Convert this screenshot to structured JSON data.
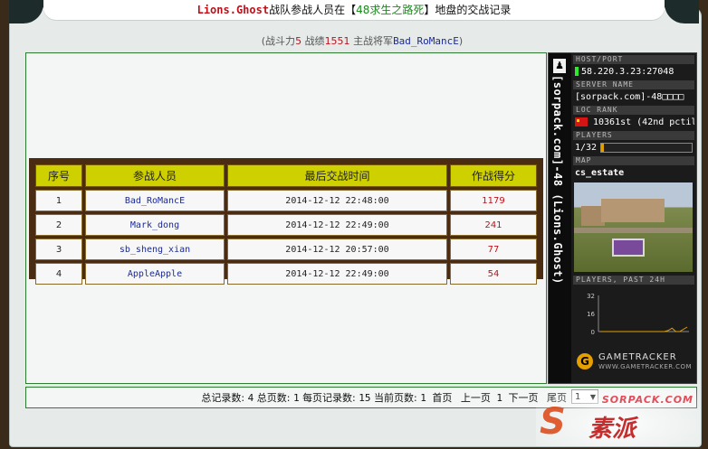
{
  "title": {
    "team": "Lions.Ghost",
    "text1": "战队参战人员在【",
    "map": "48求生之路死",
    "text2": "】地盘的交战记录"
  },
  "subtitle": {
    "open": "(战斗力",
    "power": "5",
    "record_label": "战绩",
    "record": "1551",
    "commander_label": "主战将军",
    "commander": "Bad_RoMancE",
    "close": ")"
  },
  "table": {
    "headers": [
      "序号",
      "参战人员",
      "最后交战时间",
      "作战得分"
    ],
    "rows": [
      {
        "no": "1",
        "name": "Bad_RoMancE",
        "time": "2014-12-12 22:48:00",
        "score": "1179"
      },
      {
        "no": "2",
        "name": "Mark_dong",
        "time": "2014-12-12 22:49:00",
        "score": "241"
      },
      {
        "no": "3",
        "name": "sb_sheng_xian",
        "time": "2014-12-12 20:57:00",
        "score": "77"
      },
      {
        "no": "4",
        "name": "AppleApple",
        "time": "2014-12-12 22:49:00",
        "score": "54"
      }
    ]
  },
  "gametracker": {
    "vertical_title": "[sorpack.com]-48 (Lions.Ghost)",
    "host_label": "HOST/PORT",
    "host": "58.220.3.23:27048",
    "server_label": "SERVER NAME",
    "server": "[sorpack.com]-48□□□□",
    "rank_label": "LOC RANK",
    "rank": "10361st (42nd pctile)",
    "players_label": "PLAYERS",
    "players": "1/32",
    "players_fill": 0.03125,
    "map_label": "MAP",
    "map": "cs_estate",
    "past_label": "PLAYERS, PAST 24H",
    "logo_title": "GAMETRACKER",
    "logo_url": "WWW.GAMETRACKER.COM"
  },
  "chart_data": {
    "type": "line",
    "title": "",
    "xlabel": "",
    "ylabel": "",
    "ylim": [
      0,
      32
    ],
    "yticks": [
      "32",
      "16",
      "0"
    ],
    "values": [
      0,
      0,
      0,
      0,
      0,
      0,
      0,
      0,
      0,
      0,
      0,
      0,
      0,
      0,
      0,
      0,
      0,
      0,
      1,
      3,
      0,
      0,
      2,
      4
    ],
    "grid": false
  },
  "footer": {
    "total_records_label": "总记录数:",
    "total_records": "4",
    "total_pages_label": "总页数:",
    "total_pages": "1",
    "per_page_label": "每页记录数:",
    "per_page": "15",
    "current_page_label": "当前页数:",
    "current_page": "1",
    "first": "首页",
    "prev": "上一页",
    "page_num": "1",
    "next": "下一页",
    "last": "尾页",
    "select_value": "1"
  },
  "watermark": {
    "top": "SORPACK.COM",
    "main": "素派"
  },
  "colors": {
    "accent_red": "#c0101a",
    "header_yellow": "#cfd000",
    "border_green": "#2e7d32"
  }
}
